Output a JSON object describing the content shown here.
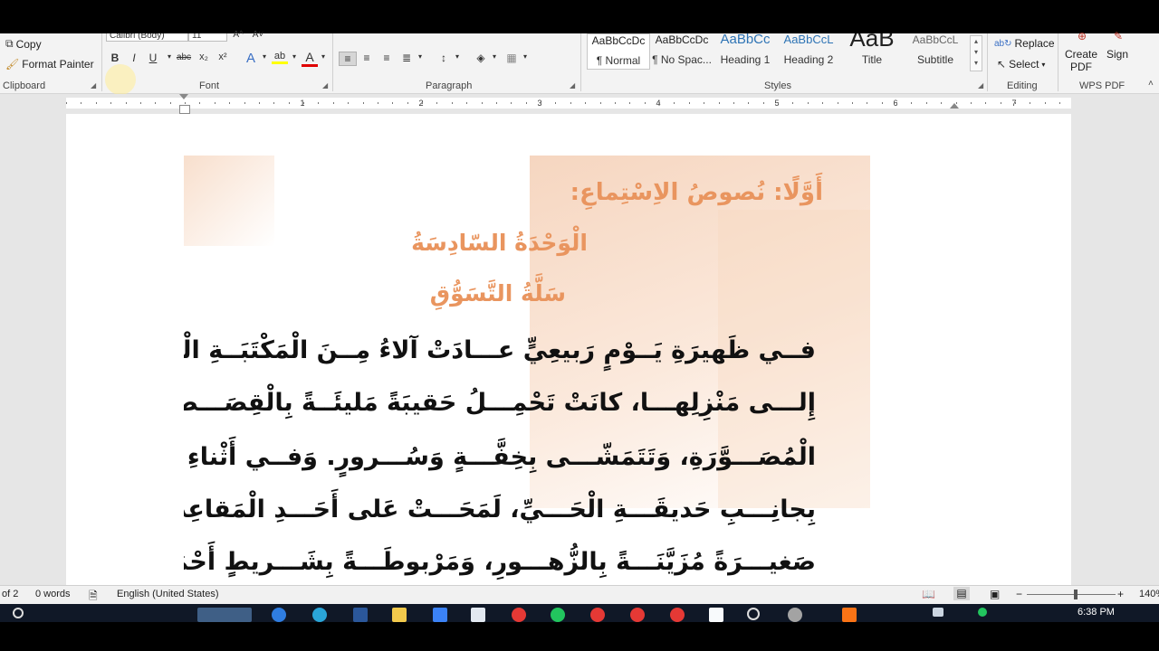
{
  "clipboard": {
    "copy_label": "Copy",
    "format_painter_label": "Format Painter",
    "group_label": "Clipboard",
    "copy_icon": "copy-icon",
    "format_painter_icon": "paintbrush-icon"
  },
  "font": {
    "font_name_value": "Calibri (Body)",
    "font_size_value": "11",
    "bold_label": "B",
    "italic_label": "I",
    "underline_label": "U",
    "strikethrough_label": "abc",
    "subscript_label": "x₂",
    "superscript_label": "x²",
    "text_effects_label": "A",
    "highlight_label": "ab",
    "font_color_label": "A",
    "group_label": "Font",
    "highlight_color": "#ffff00",
    "font_color": "#e00000"
  },
  "paragraph": {
    "group_label": "Paragraph"
  },
  "styles": {
    "group_label": "Styles",
    "items": [
      {
        "preview": "AaBbCcDc",
        "name": "¶ Normal"
      },
      {
        "preview": "AaBbCcDc",
        "name": "¶ No Spac..."
      },
      {
        "preview": "AaBbCc",
        "name": "Heading 1"
      },
      {
        "preview": "AaBbCcL",
        "name": "Heading 2"
      },
      {
        "preview": "AaB",
        "name": "Title"
      },
      {
        "preview": "AaBbCcL",
        "name": "Subtitle"
      }
    ],
    "heading_color": "#2e74b5"
  },
  "editing": {
    "replace_label": "Replace",
    "select_label": "Select",
    "group_label": "Editing"
  },
  "wps": {
    "create_pdf_label": "Create PDF",
    "sign_label": "Sign",
    "group_label": "WPS PDF"
  },
  "ruler": {
    "numbers": [
      "1",
      "1",
      "2",
      "3",
      "4",
      "5",
      "6",
      "7"
    ]
  },
  "document": {
    "heading": "أَوَّلًا: نُصوصُ الاِسْتِماعِ:",
    "unit": "الْوَحْدَةُ السّادِسَةُ",
    "lesson_title": "سَلَّةُ التَّسَوُّقِ",
    "lines": [
      "فــي ظَهيرَةِ يَــوْمٍ رَبيعِيٍّ عـــادَتْ آلاءُ مِــنَ الْمَكْتَبَــةِ الْقَريبَةِ",
      "إِلـــى مَنْزِلِهـــا، كانَتْ تَحْمِـــلُ حَقيبَةً مَليئَــةً بِالْقِصَـــصِ وَالْكُتُبِ",
      "الْمُصَـــوَّرَةِ، وَتَتَمَشّـــى بِخِفَّـــةٍ وَسُـــرورٍ. وَفــي أَثْناءِ سَـيْرِها",
      "بِجانِـــبِ حَديقَـــةِ الْحَـــيِّ، لَمَحَـــتْ عَلى أَحَـــدِ الْمَقاعِدِ سَـــلَّةً",
      "صَغيـــرَةً مُزَيَّنَـــةً بِالزُّهـــورِ، وَمَرْبوطَـــةً بِشَـــريطٍ أَحْمَـــرَ لامِعٍ."
    ]
  },
  "status": {
    "page_info": "of 2",
    "word_count": "0 words",
    "language": "English (United States)",
    "zoom_minus": "−",
    "zoom_plus": "+",
    "zoom_level": 140,
    "zoom_label": "140%"
  },
  "taskbar": {
    "time": "6:38 PM"
  }
}
